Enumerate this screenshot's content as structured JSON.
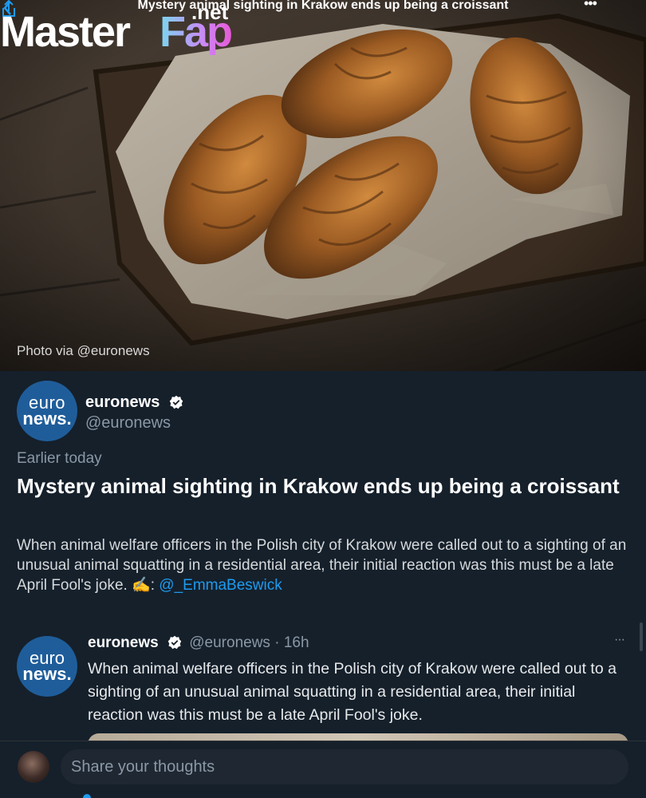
{
  "nav": {
    "title": "Mystery animal sighting in Krakow ends up being a croissant",
    "more_label": "•••"
  },
  "watermark": {
    "part1": "Master",
    "part2": "Fap",
    "part3": ".net"
  },
  "hero": {
    "photo_credit": "Photo via @euronews"
  },
  "article": {
    "avatar_line1": "euro",
    "avatar_line2": "news.",
    "author_name": "euronews",
    "author_handle": "@euronews",
    "time_label": "Earlier today",
    "headline": "Mystery animal sighting in Krakow ends up being a croissant",
    "summary_text": "When animal welfare officers in the Polish city of Krakow were called out to a sighting of an unusual animal squatting in a residential area, their initial reaction was this must be a late April Fool's joke. ✍️: ",
    "mention": "@_EmmaBeswick"
  },
  "tweet": {
    "avatar_line1": "euro",
    "avatar_line2": "news.",
    "name": "euronews",
    "meta": "@euronews · 16h",
    "more_label": "···",
    "body": "When animal welfare officers in the Polish city of Krakow were called out to a sighting of an unusual animal squatting in a residential area, their initial reaction was this must be a late April Fool's joke."
  },
  "composer": {
    "placeholder": "Share your thoughts"
  },
  "colors": {
    "background": "#15202b",
    "accent": "#1d9bf0",
    "verified": "#ffffff",
    "avatar_bg": "#1f5d9a"
  }
}
